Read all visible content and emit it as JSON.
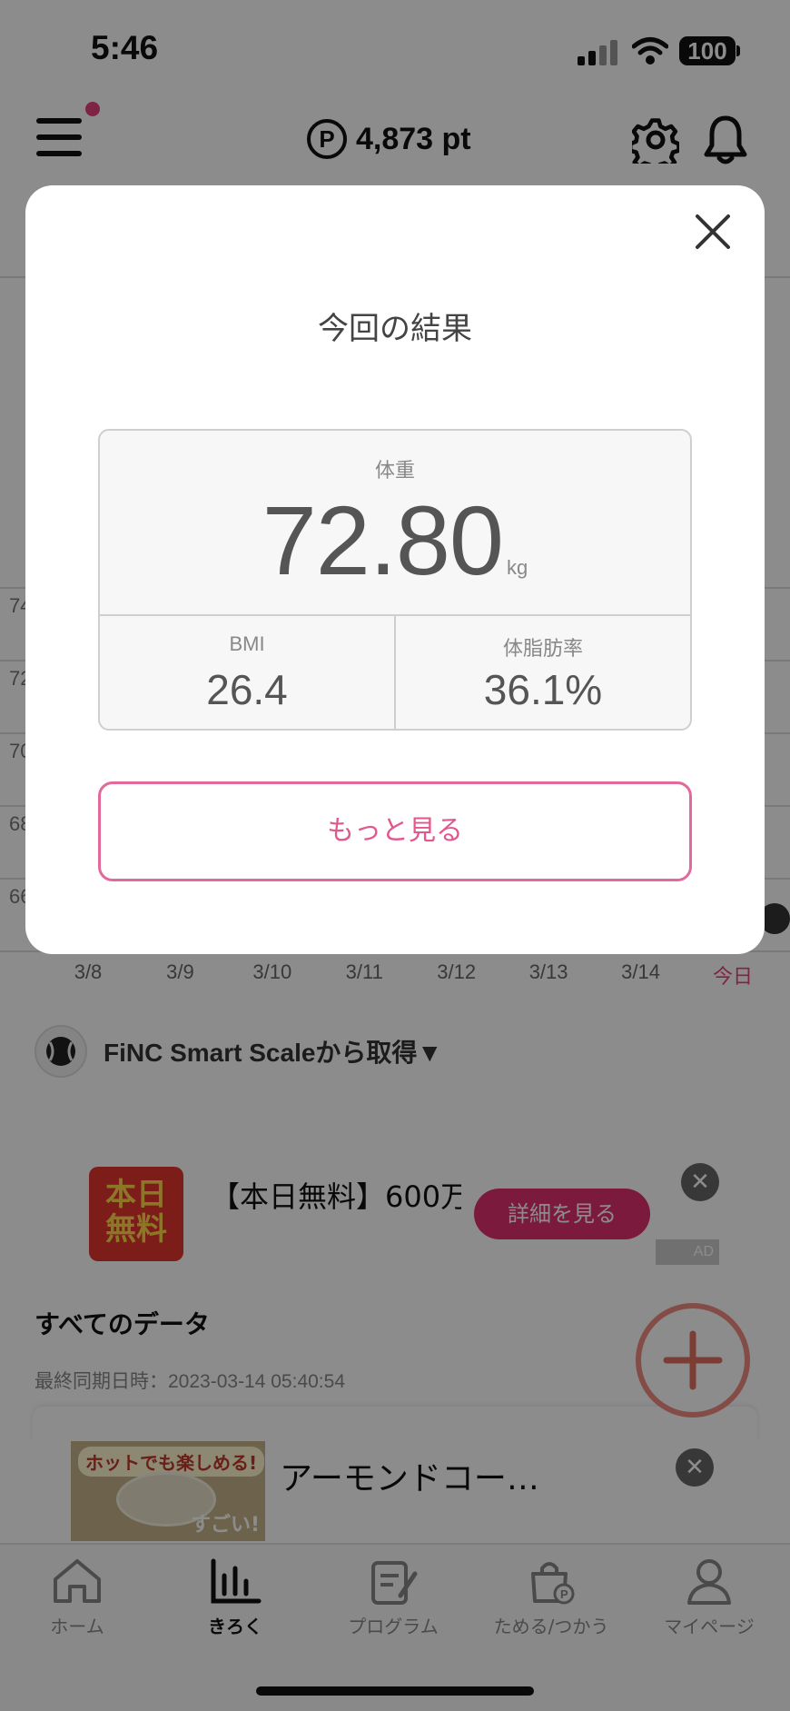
{
  "status_bar": {
    "time": "5:46",
    "battery": "100"
  },
  "header": {
    "points_symbol": "P",
    "points": "4,873 pt"
  },
  "graph": {
    "y_ticks": [
      "74",
      "72",
      "70",
      "68",
      "66"
    ],
    "dates": [
      "3/8",
      "3/9",
      "3/10",
      "3/11",
      "3/12",
      "3/13",
      "3/14",
      "今日"
    ]
  },
  "source": {
    "label": "FiNC Smart Scaleから取得▼"
  },
  "ad": {
    "thumb_text_line1": "本日",
    "thumb_text_line2": "無料",
    "text": "【本日無料】600万",
    "detail_button": "詳細を見る",
    "close": "✕",
    "badge": "AD"
  },
  "all_data": {
    "title": "すべてのデータ",
    "last_sync": "最終同期日時：2023-03-14 05:40:54"
  },
  "banner": {
    "image_hot": "ホットでも楽しめる!",
    "image_sugoi": "すごい!",
    "text": "アーモンドコー…",
    "close": "✕"
  },
  "tabs": [
    {
      "label": "ホーム",
      "icon": "home-icon"
    },
    {
      "label": "きろく",
      "icon": "chart-icon"
    },
    {
      "label": "プログラム",
      "icon": "program-icon"
    },
    {
      "label": "ためる/つかう",
      "icon": "points-bag-icon"
    },
    {
      "label": "マイページ",
      "icon": "person-icon"
    }
  ],
  "modal": {
    "title": "今回の結果",
    "weight_label": "体重",
    "weight_value": "72.80",
    "weight_unit": "kg",
    "bmi_label": "BMI",
    "bmi_value": "26.4",
    "body_fat_label": "体脂肪率",
    "body_fat_value": "36.1%",
    "more_button": "もっと見る"
  },
  "colors": {
    "accent_pink": "#e0588e",
    "today_pink": "#e8417f",
    "fab_ring": "#f08a80"
  }
}
